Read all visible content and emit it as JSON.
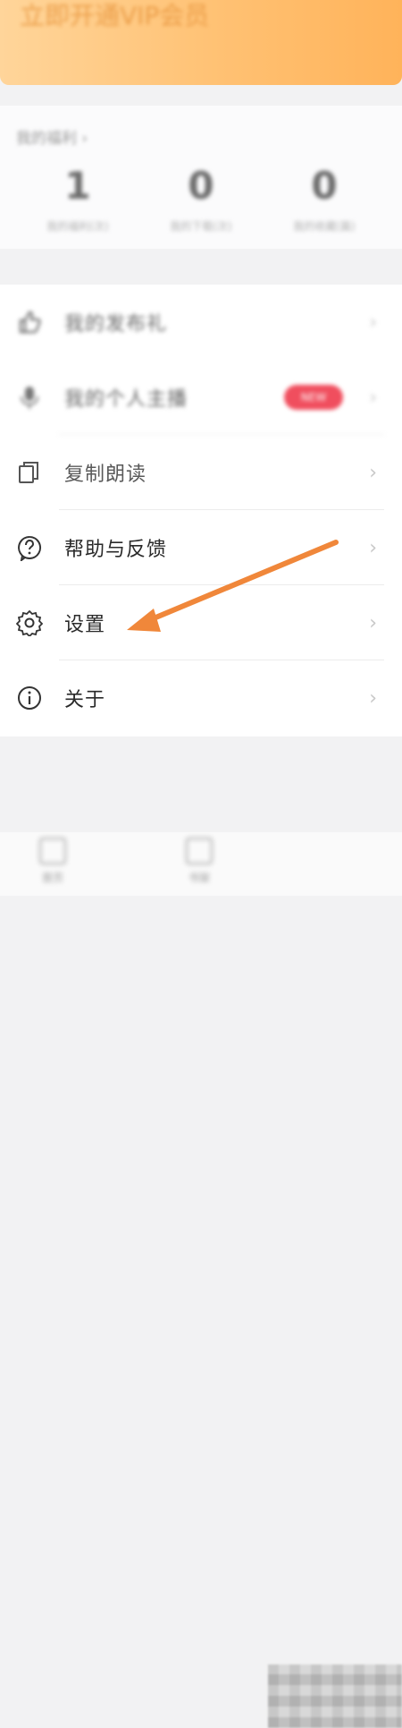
{
  "header": {
    "title": "立即开通VIP会员",
    "accent_color": "#ffc173"
  },
  "stats": {
    "label": "我的福利",
    "items": [
      {
        "value": "1",
        "label": "我的福利(次)"
      },
      {
        "value": "0",
        "label": "我的下载(次)"
      },
      {
        "value": "0",
        "label": "我的收藏(篇)"
      }
    ]
  },
  "menu": {
    "items": [
      {
        "label": "我的发布礼",
        "icon": "thumbs-up-icon"
      },
      {
        "label": "我的个人主播",
        "icon": "microphone-icon",
        "badge": "NEW"
      },
      {
        "label": "复制朗读",
        "icon": "copy-icon"
      },
      {
        "label": "帮助与反馈",
        "icon": "help-icon"
      },
      {
        "label": "设置",
        "icon": "gear-icon"
      },
      {
        "label": "关于",
        "icon": "info-icon"
      }
    ],
    "chevron": "›",
    "badge_color": "#f04e5e"
  },
  "annotation": {
    "arrow_color": "#f0873a",
    "points_to": "设置"
  },
  "tabbar": {
    "items": [
      {
        "label": "首页",
        "icon": "home-icon"
      },
      {
        "label": "书架",
        "icon": "book-icon"
      }
    ]
  }
}
